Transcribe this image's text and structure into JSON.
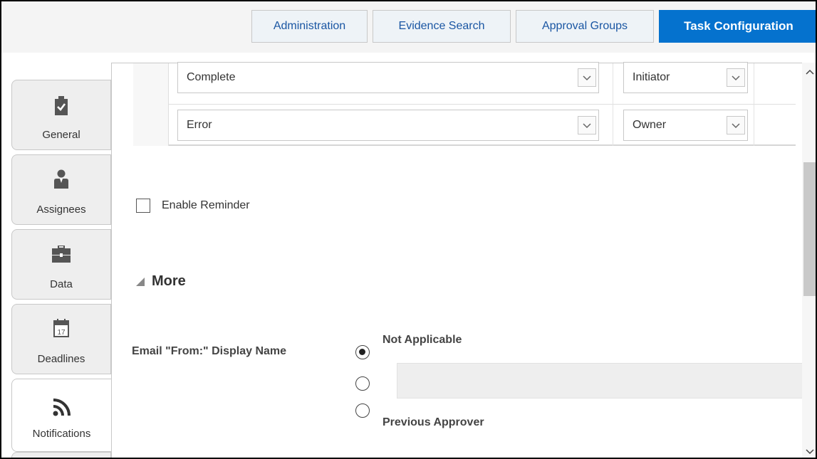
{
  "top_tabs": [
    {
      "label": "Administration"
    },
    {
      "label": "Evidence Search"
    },
    {
      "label": "Approval Groups"
    },
    {
      "label": "Task Configuration",
      "active": true
    }
  ],
  "side_tabs": [
    {
      "label": "General",
      "icon": "clipboard-check-icon"
    },
    {
      "label": "Assignees",
      "icon": "person-icon"
    },
    {
      "label": "Data",
      "icon": "briefcase-icon"
    },
    {
      "label": "Deadlines",
      "icon": "calendar-icon",
      "icon_text": "17"
    },
    {
      "label": "Notifications",
      "icon": "rss-feed-icon",
      "active": true
    }
  ],
  "notification_rows": [
    {
      "event": "Complete",
      "recipient": "Initiator"
    },
    {
      "event": "Error",
      "recipient": "Owner"
    }
  ],
  "enable_reminder": {
    "label": "Enable Reminder",
    "checked": false
  },
  "more_section": {
    "title": "More",
    "expanded": true
  },
  "email_from": {
    "label": "Email \"From:\" Display Name",
    "options": [
      {
        "label": "Not Applicable",
        "selected": true
      },
      {
        "label": "",
        "selected": false,
        "has_text_field": true,
        "value": ""
      },
      {
        "label": "Previous Approver",
        "selected": false
      }
    ]
  },
  "colors": {
    "accent": "#0572ce",
    "tab_text": "#1a56a3",
    "tab_bg": "#eef3f7",
    "side_tab_bg": "#eeeeee"
  }
}
